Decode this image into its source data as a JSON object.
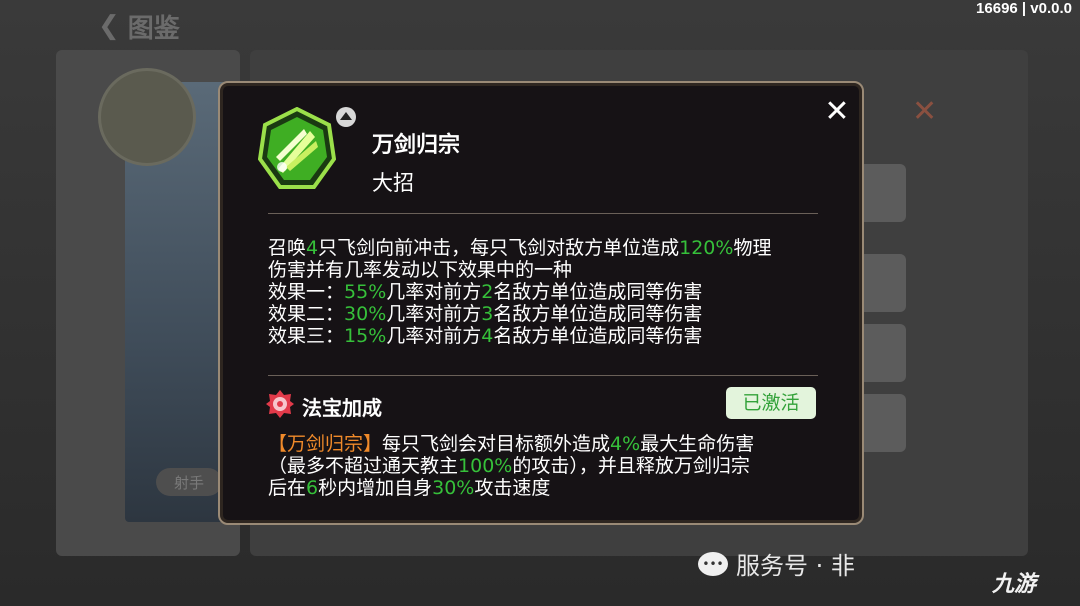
{
  "header": {
    "back_title": "图鉴",
    "version": "16696 | v0.0.0"
  },
  "background": {
    "tag_label": "射手"
  },
  "dialog": {
    "skill_name": "万剑归宗",
    "skill_type": "大招",
    "close_icon": "close-icon",
    "skill_icon": "sword-burst-icon",
    "upgrade_icon": "upgrade-arrow-icon",
    "description": {
      "l1_a": "召唤",
      "l1_b": "4",
      "l1_c": "只飞剑向前冲击，每只飞剑对敌方单位造成",
      "l1_d": "120%",
      "l1_e": "物理",
      "l2": "伤害并有几率发动以下效果中的一种",
      "e1_a": "效果一：",
      "e1_b": "55%",
      "e1_c": "几率对前方",
      "e1_d": "2",
      "e1_e": "名敌方单位造成同等伤害",
      "e2_a": "效果二：",
      "e2_b": "30%",
      "e2_c": "几率对前方",
      "e2_d": "3",
      "e2_e": "名敌方单位造成同等伤害",
      "e3_a": "效果三：",
      "e3_b": "15%",
      "e3_c": "几率对前方",
      "e3_d": "4",
      "e3_e": "名敌方单位造成同等伤害"
    },
    "treasure": {
      "title": "法宝加成",
      "status": "已激活",
      "b1_a": "【万剑归宗】",
      "b1_b": "每只飞剑会对目标额外造成",
      "b1_c": "4%",
      "b1_d": "最大生命伤害",
      "b2_a": "（最多不超过通天教主",
      "b2_b": "100%",
      "b2_c": "的攻击），并且释放万剑归宗",
      "b3_a": "后在",
      "b3_b": "6",
      "b3_c": "秒内增加自身",
      "b3_d": "30%",
      "b3_e": "攻击速度"
    }
  },
  "watermark": {
    "text": "服务号 · 非",
    "logo": "九游"
  },
  "colors": {
    "accent_green": "#36c03a",
    "accent_orange": "#f08a2a",
    "dialog_bg": "#161215",
    "border": "#9a8a76"
  }
}
